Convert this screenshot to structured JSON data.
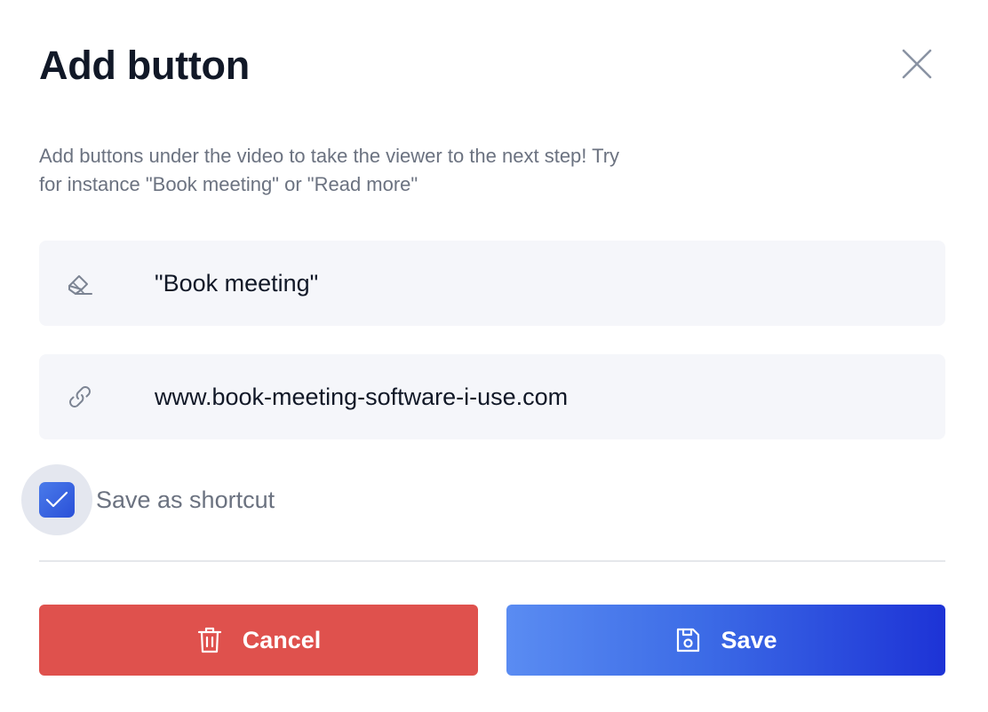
{
  "dialog": {
    "title": "Add button",
    "description": "Add buttons under the video to take the viewer to the next step! Try for instance \"Book meeting\" or \"Read more\"",
    "close_icon": "close-icon"
  },
  "form": {
    "button_label": {
      "icon": "pencil-icon",
      "value": "\"Book meeting\""
    },
    "button_url": {
      "icon": "link-icon",
      "value": "www.book-meeting-software-i-use.com"
    },
    "save_shortcut": {
      "label": "Save as shortcut",
      "checked": true
    }
  },
  "actions": {
    "cancel_label": "Cancel",
    "cancel_icon": "trash-icon",
    "save_label": "Save",
    "save_icon": "floppy-disk-icon"
  },
  "colors": {
    "cancel": "#df514d",
    "save_start": "#5a8cf2",
    "save_end": "#1d33d6",
    "checkbox": "#3560de"
  }
}
